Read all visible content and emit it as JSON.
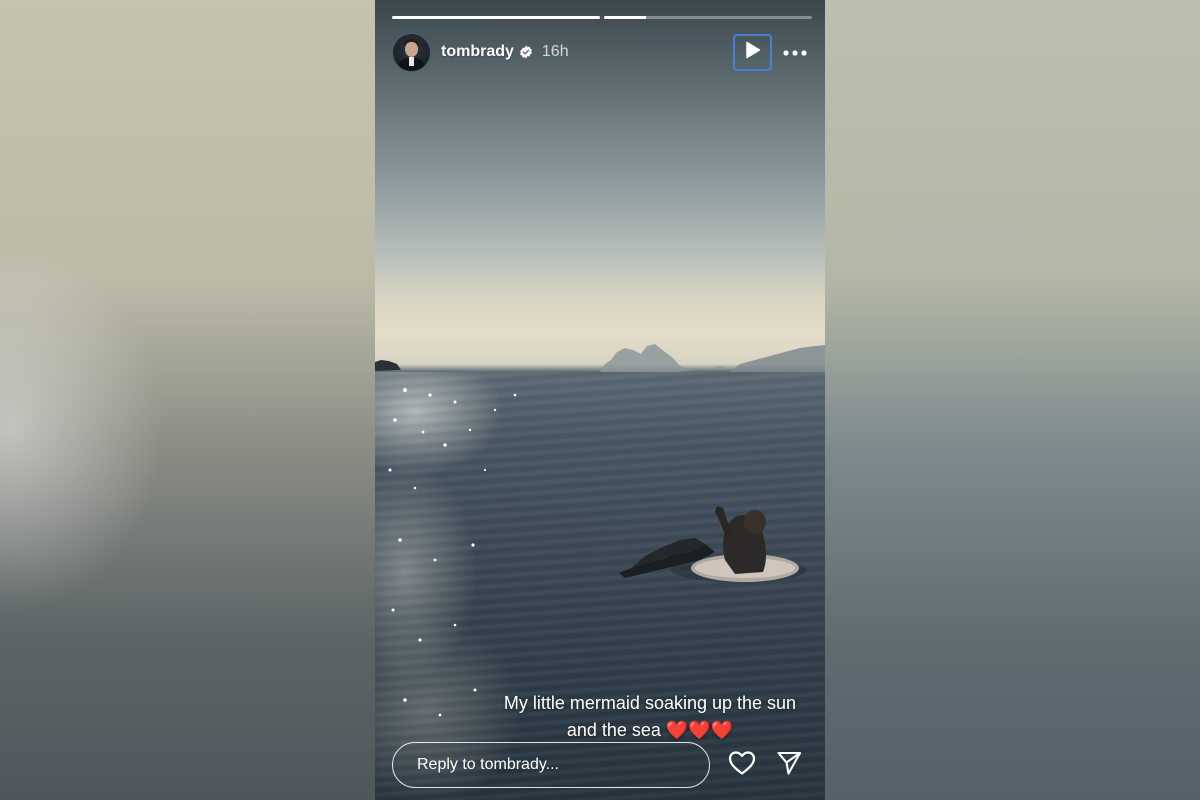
{
  "story": {
    "progress": [
      1.0,
      0.2
    ],
    "user": {
      "username": "tombrady",
      "verified": true,
      "time_ago": "16h",
      "avatar_alt": "tombrady profile picture"
    },
    "controls": {
      "play_icon": "play-icon",
      "more_icon": "more-options-icon"
    },
    "caption": {
      "line1": "My little mermaid soaking up the sun",
      "line2": "and the sea ❤️❤️❤️"
    },
    "reply": {
      "placeholder": "Reply to tombrady...",
      "value": ""
    },
    "actions": {
      "like_icon": "heart-icon",
      "share_icon": "send-icon"
    }
  },
  "colors": {
    "accent": "#4a7fd6",
    "text": "#ffffff"
  }
}
